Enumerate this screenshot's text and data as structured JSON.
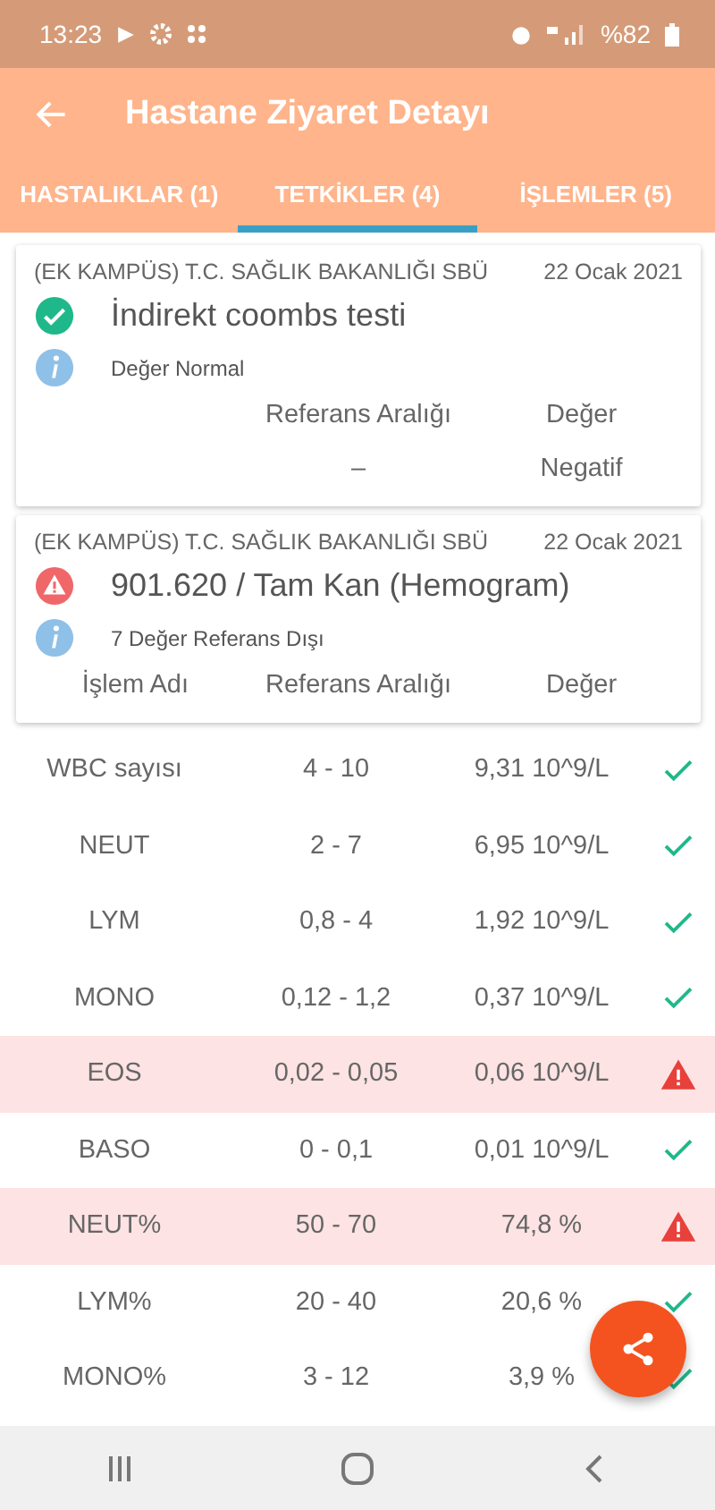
{
  "status_bar": {
    "time": "13:23",
    "battery": "%82"
  },
  "app_bar": {
    "title": "Hastane Ziyaret Detayı"
  },
  "tabs": [
    {
      "label": "HASTALIKLAR (1)",
      "selected": false
    },
    {
      "label": "TETKİKLER (4)",
      "selected": true
    },
    {
      "label": "İŞLEMLER (5)",
      "selected": false
    }
  ],
  "cards": [
    {
      "hospital": "(EK KAMPÜS) T.C. SAĞLIK BAKANLIĞI SBÜ",
      "date": "22 Ocak 2021",
      "abnormal": false,
      "title": "İndirekt coombs testi",
      "info": "Değer Normal",
      "columns": [
        "",
        "Referans Aralığı",
        "Değer"
      ],
      "rows": [
        {
          "cells": [
            "",
            "–",
            "Negatif"
          ]
        }
      ]
    },
    {
      "hospital": "(EK KAMPÜS) T.C. SAĞLIK BAKANLIĞI SBÜ",
      "date": "22 Ocak 2021",
      "abnormal": true,
      "title": "901.620 / Tam Kan (Hemogram)",
      "info": "7 Değer Referans Dışı",
      "columns": [
        "İşlem Adı",
        "Referans Aralığı",
        "Değer"
      ]
    }
  ],
  "results": [
    {
      "name": "WBC sayısı",
      "range": "4 - 10",
      "value": "9,31 10^9/L",
      "abnormal": false
    },
    {
      "name": "NEUT",
      "range": "2 - 7",
      "value": "6,95 10^9/L",
      "abnormal": false
    },
    {
      "name": "LYM",
      "range": "0,8 - 4",
      "value": "1,92 10^9/L",
      "abnormal": false
    },
    {
      "name": "MONO",
      "range": "0,12 - 1,2",
      "value": "0,37 10^9/L",
      "abnormal": false
    },
    {
      "name": "EOS",
      "range": "0,02 - 0,05",
      "value": "0,06 10^9/L",
      "abnormal": true
    },
    {
      "name": "BASO",
      "range": "0 - 0,1",
      "value": "0,01 10^9/L",
      "abnormal": false
    },
    {
      "name": "NEUT%",
      "range": "50 - 70",
      "value": "74,8 %",
      "abnormal": true
    },
    {
      "name": "LYM%",
      "range": "20 - 40",
      "value": "20,6 %",
      "abnormal": false
    },
    {
      "name": "MONO%",
      "range": "3 - 12",
      "value": "3,9 %",
      "abnormal": false
    }
  ]
}
